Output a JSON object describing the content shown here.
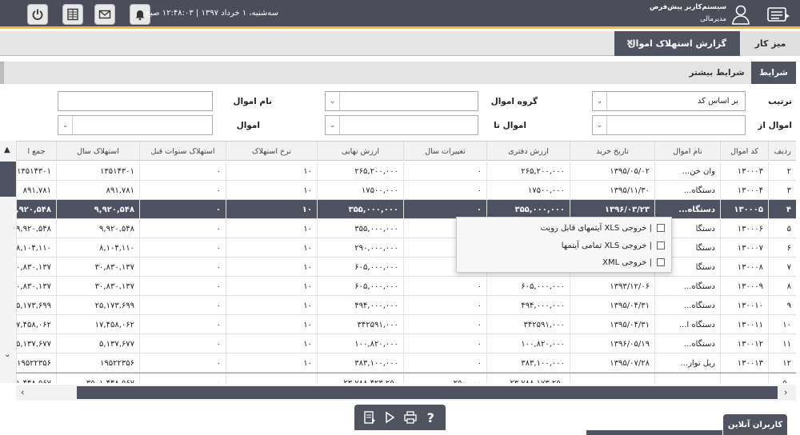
{
  "topbar": {
    "datetime": "سه‌شنبه، ۱ خرداد ۱۳۹۷ | ۱۲:۴۸:۰۳ صبح",
    "user_name": "سیستم‌کاربر پیش‌فرض",
    "user_role": "مدیرمالی",
    "icons": [
      "power-icon",
      "report-icon",
      "mail-icon",
      "bell-icon",
      "user-icon",
      "menu-icon"
    ]
  },
  "tabs": {
    "desk": "میز کار",
    "report": "گزارش استهلاک اموال",
    "close_glyph": "✖"
  },
  "subtabs": {
    "conditions": "شرایط",
    "more_conditions": "شرایط بیشتر"
  },
  "filters": {
    "sort_label": "ترتیب",
    "sort_value": "بر اساس کد",
    "group_label": "گروه اموال",
    "group_value": "",
    "name_label": "نام اموال",
    "name_value": "",
    "from_label": "اموال از",
    "from_value": "",
    "to_label": "اموال تا",
    "to_value": "",
    "asset_label": "اموال",
    "asset_value": ""
  },
  "table": {
    "columns": [
      "ردیف",
      "کد اموال",
      "نام اموال",
      "تاریخ خرید",
      "ارزش دفتری",
      "تغییرات سال",
      "ارزش نهایی",
      "نرخ استهلاک",
      "استهلاک سنوات قبل",
      "استهلاک سال",
      "جمع ا"
    ],
    "rows": [
      [
        "۲",
        "۱۳۰۰۰۳",
        "وان خن...",
        "۱۳۹۵/۰۵/۰۲",
        "۲۶۵,۲۰۰,۰۰۰",
        "۰",
        "۲۶۵,۲۰۰,۰۰۰",
        "۱۰",
        "۰",
        "۱۳۵۱۴۳۰۱",
        "۱۳۵۱۴۳۰۱"
      ],
      [
        "۳",
        "۱۳۰۰۰۴",
        "دستگاه...",
        "۱۳۹۵/۱۱/۳۰",
        "۱۷۵۰۰,۰۰۰",
        "۰",
        "۱۷۵۰۰,۰۰۰",
        "۱۰",
        "۰",
        "۸۹۱,۷۸۱",
        "۸۹۱,۷۸۱"
      ],
      [
        "۴",
        "۱۳۰۰۰۵",
        "دستگاه...",
        "۱۳۹۶/۰۳/۲۳",
        "۳۵۵,۰۰۰,۰۰۰",
        "۰",
        "۳۵۵,۰۰۰,۰۰۰",
        "۱۰",
        "۰",
        "۹,۹۲۰,۵۴۸",
        "۹,۹۲۰,۵۴۸"
      ],
      [
        "۵",
        "۱۳۰۰۰۶",
        "دستگا",
        "",
        "",
        "",
        "۳۵۵,۰۰۰,۰۰۰",
        "۱۰",
        "۰",
        "۹,۹۲۰,۵۴۸",
        "۹,۹۲۰,۵۴۸"
      ],
      [
        "۶",
        "۱۳۰۰۰۷",
        "دستگا",
        "",
        "",
        "",
        "۲۹۰,۰۰۰,۰۰۰",
        "۱۰",
        "۰",
        "۸,۱۰۴,۱۱۰",
        "۸,۱۰۴,۱۱۰"
      ],
      [
        "۷",
        "۱۳۰۰۰۸",
        "دستگا",
        "",
        "",
        "",
        "۶۰۵,۰۰۰,۰۰۰",
        "۱۰",
        "۰",
        "۳۰,۸۳۰,۱۳۷",
        "۳۰,۸۳۰,۱۳۷"
      ],
      [
        "۸",
        "۱۳۰۰۰۹",
        "دستگاه...",
        "۱۳۹۳/۱۲/۰۶",
        "۶۰۵,۰۰۰,۰۰۰",
        "۰",
        "۶۰۵,۰۰۰,۰۰۰",
        "۱۰",
        "۰",
        "۳۰,۸۳۰,۱۳۷",
        "۳۰,۸۳۰,۱۳۷"
      ],
      [
        "۹",
        "۱۳۰۰۱۰",
        "دستگاه...",
        "۱۳۹۵/۰۴/۳۱",
        "۴۹۴,۰۰۰,۰۰۰",
        "۰",
        "۴۹۴,۰۰۰,۰۰۰",
        "۱۰",
        "۰",
        "۲۵,۱۷۳,۶۹۹",
        "۲۵,۱۷۳,۶۹۹"
      ],
      [
        "۱۰",
        "۱۳۰۰۱۱",
        "دستگاه ا...",
        "۱۳۹۵/۰۴/۳۱",
        "۳۴۲۵۹۱,۰۰۰",
        "۰",
        "۳۴۲۵۹۱,۰۰۰",
        "۱۰",
        "۰",
        "۱۷,۴۵۸,۰۶۲",
        "۱۷,۴۵۸,۰۶۲"
      ],
      [
        "۱۱",
        "۱۳۰۰۱۲",
        "دستگاه...",
        "۱۳۹۶/۰۵/۱۹",
        "۱۰۰,۸۲۰,۰۰۰",
        "۰",
        "۱۰۰,۸۲۰,۰۰۰",
        "۱۰",
        "۰",
        "۵,۱۳۷,۶۷۷",
        "۵,۱۳۷,۶۷۷"
      ],
      [
        "۱۲",
        "۱۳۰۰۱۳",
        "ریل توار...",
        "۱۳۹۵/۰۷/۲۸",
        "۳۸۳,۱۰۰,۰۰۰",
        "۰",
        "۳۸۳,۱۰۰,۰۰۰",
        "۱۰",
        "۰",
        "۱۹۵۲۲۳۵۶",
        "۱۹۵۲۲۳۵۶"
      ]
    ],
    "selected_row": 2,
    "summary": [
      "۵۰",
      "",
      "",
      "",
      "۲۳,۷۸۸,۱۷۳,۲۵۰",
      "۲۵۰,۰۰۰",
      "۲۳,۷۸۸,۴۲۳,۲۵۰",
      "",
      "۰",
      "۳۵۰۱,۴۴۸,۵۶۷",
      "۳۵۰۱,۴۴۸,۵۶۷"
    ]
  },
  "context_menu": {
    "items": [
      "| خروجی XLS آیتمهای قابل رویت",
      "| خروجی XLS تمامی آیتمها",
      "| خروجی XML"
    ]
  },
  "bottom_toolbar": {
    "icons": [
      "export-icon",
      "play-icon",
      "print-icon",
      "help-icon"
    ],
    "help_glyph": "?"
  },
  "online_users": "کاربران آنلاین",
  "scroll_glyphs": {
    "up": "▲",
    "down": "⌄",
    "left": "‹",
    "right": "›",
    "dropdown": "⌄"
  }
}
